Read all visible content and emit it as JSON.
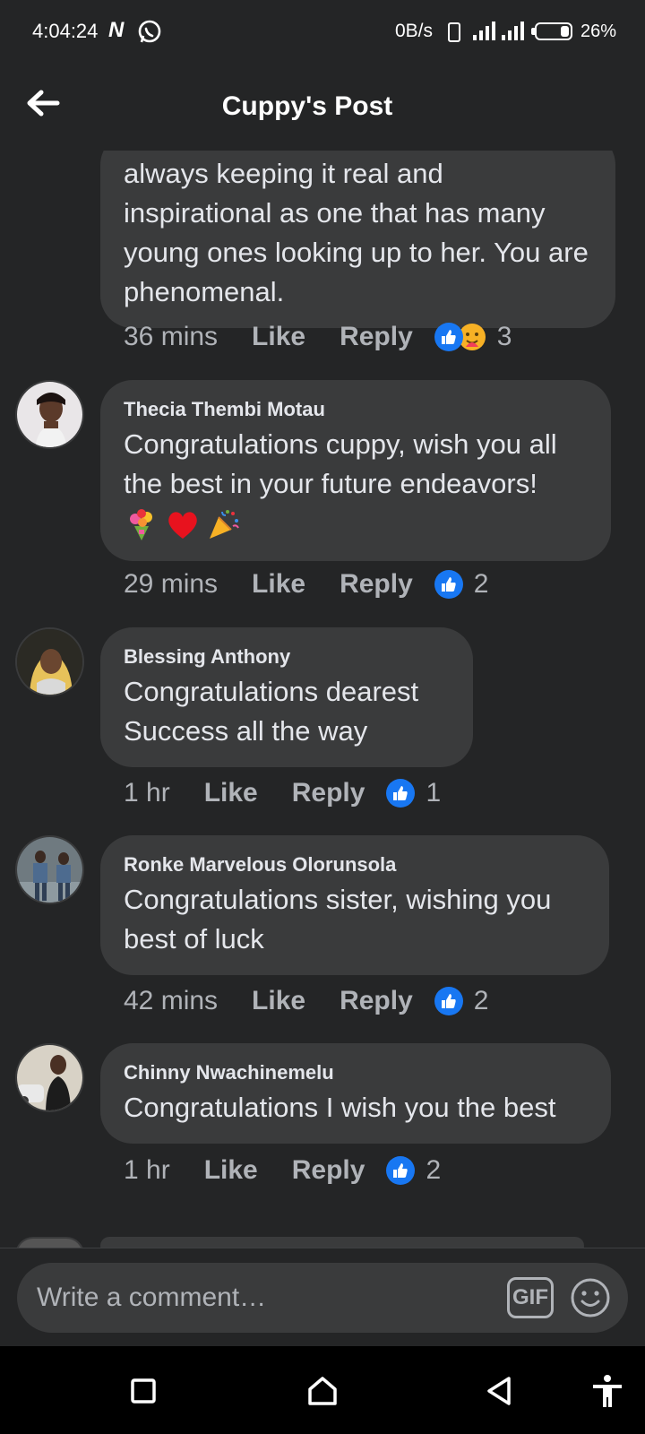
{
  "status_bar": {
    "time": "4:04:24",
    "network_speed": "0B/s",
    "battery": "26%",
    "battery_level": 0.26,
    "icons": [
      "netflix-n-icon",
      "whatsapp-icon",
      "vibrate-icon",
      "signal-icon",
      "signal-icon-2",
      "battery-icon"
    ]
  },
  "header": {
    "title": "Cuppy's Post",
    "back_icon": "back-arrow-icon"
  },
  "comments": [
    {
      "author": "",
      "text": "always keeping it real and inspirational as one that has many young ones looking up to her. You are phenomenal.",
      "time": "36 mins",
      "like_label": "Like",
      "reply_label": "Reply",
      "reactions": [
        "like",
        "care"
      ],
      "reaction_count": "3"
    },
    {
      "author": "Thecia Thembi Motau",
      "text": "Congratulations cuppy, wish you all the best in your future endeavors!",
      "emojis": [
        "bouquet-emoji",
        "heart-emoji",
        "party-popper-emoji"
      ],
      "time": "29 mins",
      "like_label": "Like",
      "reply_label": "Reply",
      "reactions": [
        "like"
      ],
      "reaction_count": "2"
    },
    {
      "author": "Blessing Anthony",
      "text": "Congratulations dearest Success all the way",
      "time": "1 hr",
      "like_label": "Like",
      "reply_label": "Reply",
      "reactions": [
        "like"
      ],
      "reaction_count": "1"
    },
    {
      "author": "Ronke Marvelous Olorunsola",
      "text": "Congratulations sister, wishing you best of luck",
      "time": "42 mins",
      "like_label": "Like",
      "reply_label": "Reply",
      "reactions": [
        "like"
      ],
      "reaction_count": "2"
    },
    {
      "author": "Chinny Nwachinemelu",
      "text": "Congratulations I wish you the best",
      "time": "1 hr",
      "like_label": "Like",
      "reply_label": "Reply",
      "reactions": [
        "like"
      ],
      "reaction_count": "2"
    }
  ],
  "composer": {
    "placeholder": "Write a comment…",
    "gif_label": "GIF"
  },
  "navbar": {
    "items": [
      "recents-square-icon",
      "home-icon",
      "back-triangle-icon",
      "accessibility-icon"
    ]
  },
  "colors": {
    "background": "#242526",
    "bubble": "#3a3b3c",
    "text": "#e4e6eb",
    "muted": "#b0b3b8",
    "like_blue": "#1877f2"
  }
}
